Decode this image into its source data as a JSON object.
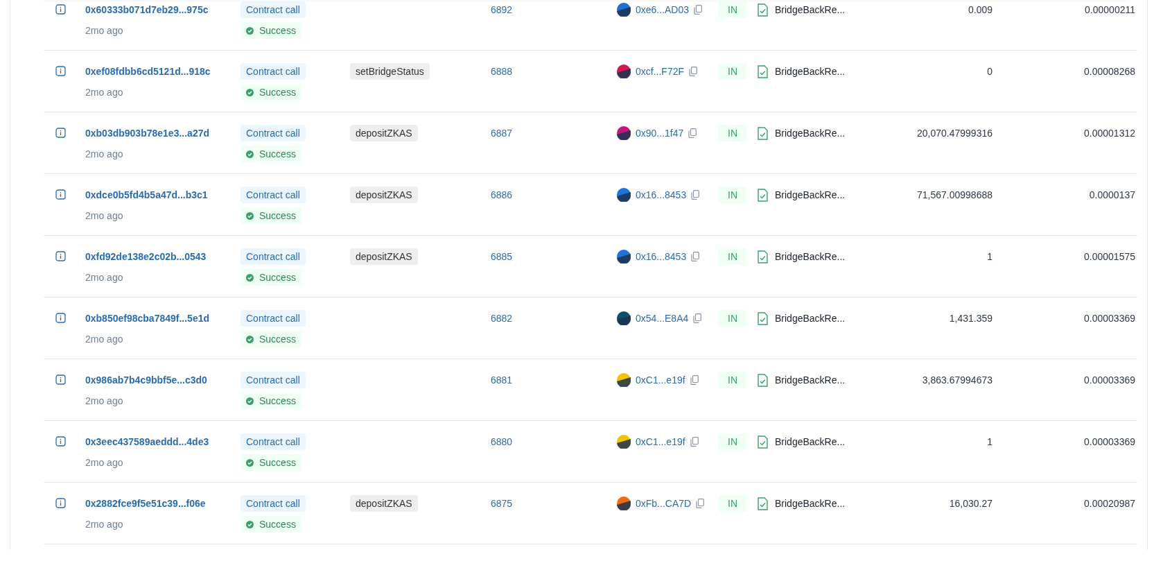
{
  "transactions": [
    {
      "hash": "0x60333b071d7eb29...975c",
      "time": "2mo ago",
      "type": "Contract call",
      "status": "Success",
      "block": "6892",
      "from": "0xe6...AD03",
      "color": "#1f6fd6",
      "direction": "IN",
      "to": "BridgeBackRe...",
      "value": "0.009",
      "fee": "0.00000211"
    },
    {
      "hash": "0xef08fdbb6cd5121d...918c",
      "time": "2mo ago",
      "type": "Contract call",
      "status": "Success",
      "method": "setBridgeStatus",
      "block": "6888",
      "from": "0xcf...F72F",
      "color": "#d01a4f",
      "direction": "IN",
      "to": "BridgeBackRe...",
      "value": "0",
      "fee": "0.00008268"
    },
    {
      "hash": "0xb03db903b78e1e3...a27d",
      "time": "2mo ago",
      "type": "Contract call",
      "status": "Success",
      "method": "depositZKAS",
      "block": "6887",
      "from": "0x90...1f47",
      "color": "#c2187a",
      "direction": "IN",
      "to": "BridgeBackRe...",
      "value": "20,070.47999316",
      "fee": "0.00001312"
    },
    {
      "hash": "0xdce0b5fd4b5a47d...b3c1",
      "time": "2mo ago",
      "type": "Contract call",
      "status": "Success",
      "method": "depositZKAS",
      "block": "6886",
      "from": "0x16...8453",
      "color": "#1f73d9",
      "direction": "IN",
      "to": "BridgeBackRe...",
      "value": "71,567.00998688",
      "fee": "0.0000137"
    },
    {
      "hash": "0xfd92de138e2c02b...0543",
      "time": "2mo ago",
      "type": "Contract call",
      "status": "Success",
      "method": "depositZKAS",
      "block": "6885",
      "from": "0x16...8453",
      "color": "#1f73d9",
      "direction": "IN",
      "to": "BridgeBackRe...",
      "value": "1",
      "fee": "0.00001575"
    },
    {
      "hash": "0xb850ef98cba7849f...5e1d",
      "time": "2mo ago",
      "type": "Contract call",
      "status": "Success",
      "block": "6882",
      "from": "0x54...E8A4",
      "color": "#0a4f6e",
      "direction": "IN",
      "to": "BridgeBackRe...",
      "value": "1,431.359",
      "fee": "0.00003369"
    },
    {
      "hash": "0x986ab7b4c9bbf5e...c3d0",
      "time": "2mo ago",
      "type": "Contract call",
      "status": "Success",
      "block": "6881",
      "from": "0xC1...e19f",
      "color": "#f2c400",
      "direction": "IN",
      "to": "BridgeBackRe...",
      "value": "3,863.67994673",
      "fee": "0.00003369"
    },
    {
      "hash": "0x3eec437589aeddd...4de3",
      "time": "2mo ago",
      "type": "Contract call",
      "status": "Success",
      "block": "6880",
      "from": "0xC1...e19f",
      "color": "#f2c400",
      "direction": "IN",
      "to": "BridgeBackRe...",
      "value": "1",
      "fee": "0.00003369"
    },
    {
      "hash": "0x2882fce9f5e51c39...f06e",
      "time": "2mo ago",
      "type": "Contract call",
      "status": "Success",
      "method": "depositZKAS",
      "block": "6875",
      "from": "0xFb...CA7D",
      "color": "#f26a10",
      "direction": "IN",
      "to": "BridgeBackRe...",
      "value": "16,030.27",
      "fee": "0.00020987"
    }
  ]
}
